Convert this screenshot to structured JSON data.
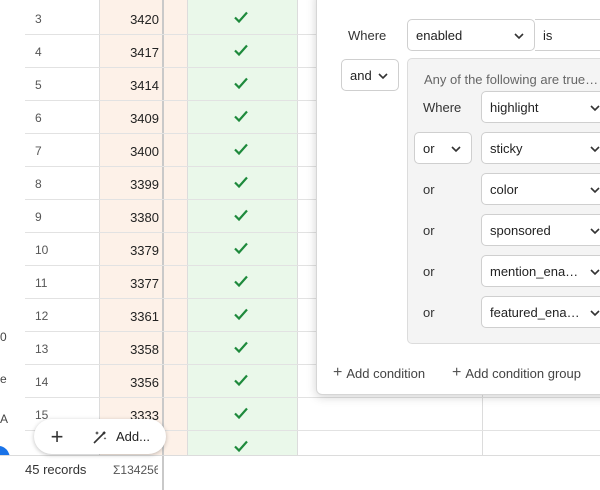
{
  "left_glyphs": [
    "0",
    "e",
    "A"
  ],
  "rows": [
    {
      "num": "3",
      "value": "3420",
      "checked": true
    },
    {
      "num": "4",
      "value": "3417",
      "checked": true
    },
    {
      "num": "5",
      "value": "3414",
      "checked": true
    },
    {
      "num": "6",
      "value": "3409",
      "checked": true
    },
    {
      "num": "7",
      "value": "3400",
      "checked": true
    },
    {
      "num": "8",
      "value": "3399",
      "checked": true
    },
    {
      "num": "9",
      "value": "3380",
      "checked": true
    },
    {
      "num": "10",
      "value": "3379",
      "checked": true
    },
    {
      "num": "11",
      "value": "3377",
      "checked": true
    },
    {
      "num": "12",
      "value": "3361",
      "checked": true
    },
    {
      "num": "13",
      "value": "3358",
      "checked": true
    },
    {
      "num": "14",
      "value": "3356",
      "checked": true
    },
    {
      "num": "15",
      "value": "3333",
      "checked": true
    },
    {
      "num": "",
      "value": "",
      "checked": true
    }
  ],
  "footer": {
    "records": "45 records",
    "sum": "Σ134256"
  },
  "add_pill": {
    "plus": "+",
    "add_label": "Add..."
  },
  "filter": {
    "where_label": "Where",
    "field": "enabled",
    "operator": "is",
    "conjunction": "and",
    "group": {
      "title": "Any of the following are true…",
      "conditions": [
        {
          "connector": "Where",
          "field": "highlight",
          "connector_is_dropdown": false
        },
        {
          "connector": "or",
          "field": "sticky",
          "connector_is_dropdown": true
        },
        {
          "connector": "or",
          "field": "color",
          "connector_is_dropdown": false
        },
        {
          "connector": "or",
          "field": "sponsored",
          "connector_is_dropdown": false
        },
        {
          "connector": "or",
          "field": "mention_ena…",
          "connector_is_dropdown": false
        },
        {
          "connector": "or",
          "field": "featured_ena…",
          "connector_is_dropdown": false
        }
      ]
    },
    "add_condition": "Add condition",
    "add_condition_group": "Add condition group"
  },
  "colors": {
    "check": "#1e8a3c",
    "accent_blue": "#1a73e8",
    "orange_col": "#fdf1e8",
    "green_col": "#eaf8ea"
  }
}
